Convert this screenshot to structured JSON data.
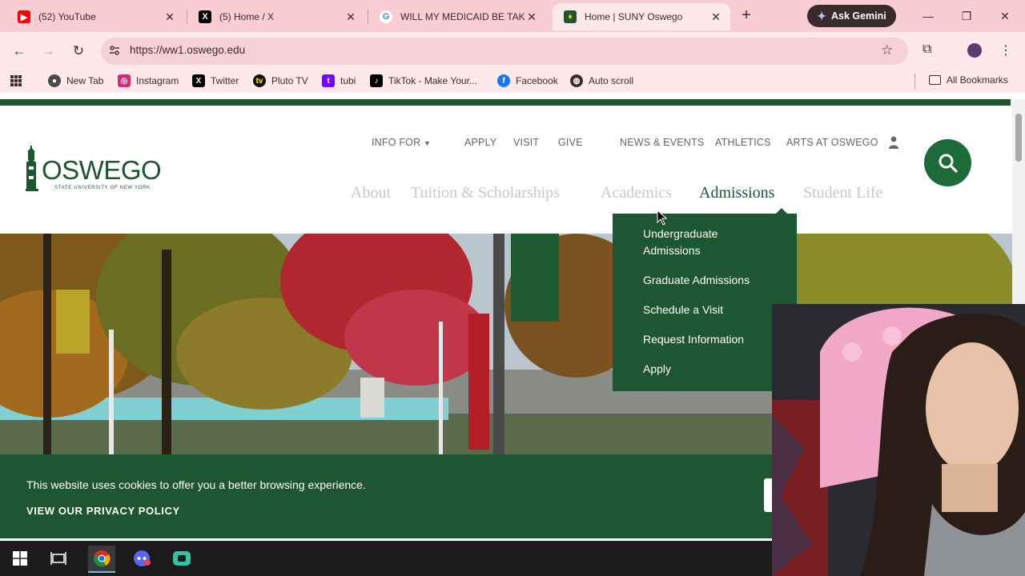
{
  "browser": {
    "tabs": [
      {
        "title": "(52) YouTube",
        "icon": "youtube-icon",
        "active": false
      },
      {
        "title": "(5) Home / X",
        "icon": "x-icon",
        "active": false
      },
      {
        "title": "WILL MY MEDICAID BE TAKE",
        "icon": "google-icon",
        "active": false
      },
      {
        "title": "Home | SUNY Oswego",
        "icon": "oswego-icon",
        "active": true
      }
    ],
    "gemini_label": "Ask Gemini",
    "url": "https://ww1.oswego.edu",
    "bookmarks": [
      {
        "label": "New Tab",
        "icon": "chrome-icon"
      },
      {
        "label": "Instagram",
        "icon": "instagram-icon"
      },
      {
        "label": "Twitter",
        "icon": "x-icon"
      },
      {
        "label": "Pluto TV",
        "icon": "pluto-tv-icon"
      },
      {
        "label": "tubi",
        "icon": "tubi-icon"
      },
      {
        "label": "TikTok - Make Your...",
        "icon": "tiktok-icon"
      },
      {
        "label": "Facebook",
        "icon": "facebook-icon"
      },
      {
        "label": "Auto scroll",
        "icon": "globe-icon"
      }
    ],
    "all_bookmarks_label": "All Bookmarks",
    "colors": {
      "tabbar": "#f9cdd3",
      "toolbar": "#fde9ec"
    }
  },
  "site": {
    "logo": {
      "name": "OSWEGO",
      "tagline": "STATE UNIVERSITY OF NEW YORK"
    },
    "top_nav": {
      "info_for": "INFO FOR",
      "apply": "APPLY",
      "visit": "VISIT",
      "give": "GIVE",
      "news_events": "NEWS & EVENTS",
      "athletics": "ATHLETICS",
      "arts": "ARTS AT OSWEGO"
    },
    "main_nav": {
      "about": "About",
      "tuition": "Tuition & Scholarships",
      "academics": "Academics",
      "admissions": "Admissions",
      "student_life": "Student Life"
    },
    "admissions_menu": {
      "undergrad_line1": "Undergraduate",
      "undergrad_line2": "Admissions",
      "graduate": "Graduate Admissions",
      "schedule": "Schedule a Visit",
      "request_info": "Request Information",
      "apply": "Apply"
    },
    "cookie_banner": {
      "message": "This website uses cookies to offer you a better browsing experience.",
      "privacy_link": "VIEW OUR PRIVACY POLICY"
    },
    "colors": {
      "brand_green": "#1e5631",
      "nav_faded": "#c4cdc6"
    }
  },
  "taskbar": {
    "apps": [
      "windows-start-icon",
      "task-view-icon",
      "chrome-icon",
      "discord-icon",
      "streamlabs-icon"
    ]
  }
}
